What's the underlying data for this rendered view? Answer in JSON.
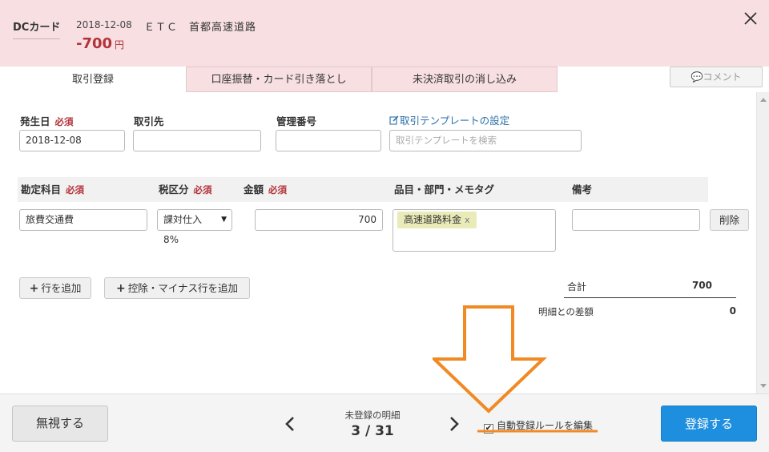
{
  "header": {
    "account": "DCカード",
    "date": "2018-12-08",
    "description": "ＥＴＣ　首都高速道路",
    "amount": "-700",
    "unit": "円"
  },
  "tabs": [
    {
      "label": "取引登録",
      "active": true
    },
    {
      "label": "口座振替・カード引き落とし",
      "active": false
    },
    {
      "label": "未決済取引の消し込み",
      "active": false
    }
  ],
  "comment_button": "💬コメント",
  "fields": {
    "date_label": "発生日",
    "required": "必須",
    "date_value": "2018-12-08",
    "partner_label": "取引先",
    "partner_value": "",
    "manage_label": "管理番号",
    "manage_value": "",
    "template_link": "取引テンプレートの設定",
    "template_placeholder": "取引テンプレートを検索"
  },
  "table": {
    "headers": [
      "勘定科目",
      "税区分",
      "金額",
      "品目・部門・メモタグ",
      "備考"
    ],
    "row": {
      "account": "旅費交通費",
      "tax": "課対仕入8%",
      "amount": "700",
      "tag": "高速道路料金",
      "tag_remove": "x",
      "memo": "",
      "delete": "削除"
    }
  },
  "buttons": {
    "add_row": "行を追加",
    "add_minus_row": "控除・マイナス行を追加"
  },
  "totals": {
    "total_label": "合計",
    "total_value": "700",
    "diff_label": "明細との差額",
    "diff_value": "0"
  },
  "footer": {
    "ignore": "無視する",
    "nav_title": "未登録の明細",
    "nav_count": "3 / 31",
    "rule_label": "自動登録ルールを編集",
    "rule_checked": true,
    "register": "登録する"
  },
  "colors": {
    "header_bg": "#f7dfe2",
    "required": "#b3333a",
    "primary": "#1e8fde",
    "annotation": "#f08a24",
    "tag_bg": "#e9ecb8"
  }
}
